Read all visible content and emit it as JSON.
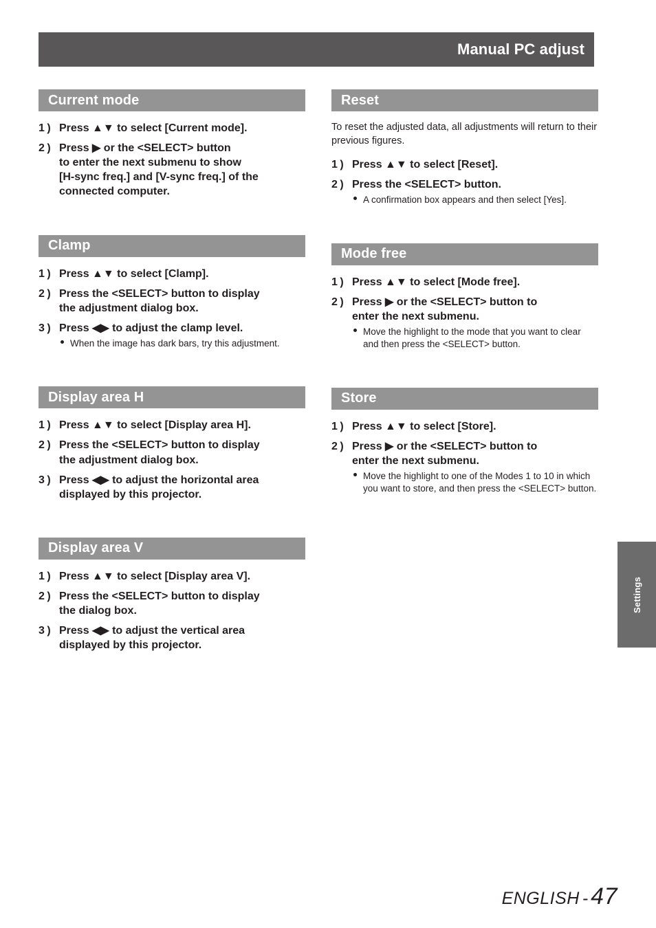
{
  "header": {
    "title": "Manual PC adjust"
  },
  "left_column": {
    "sections": [
      {
        "heading": "Current mode",
        "intro": "",
        "steps": [
          {
            "num": "1 )",
            "lines": [
              "Press ▲▼ to select [Current mode]."
            ],
            "notes": []
          },
          {
            "num": "2 )",
            "lines": [
              "Press ▶ or the <SELECT> button",
              "to enter the next submenu to show",
              "[H-sync freq.] and [V-sync freq.] of the",
              "connected computer."
            ],
            "notes": []
          }
        ]
      },
      {
        "heading": "Clamp",
        "intro": "",
        "steps": [
          {
            "num": "1 )",
            "lines": [
              "Press ▲▼ to select [Clamp]."
            ],
            "notes": []
          },
          {
            "num": "2 )",
            "lines": [
              "Press the <SELECT> button to display",
              "the adjustment dialog box."
            ],
            "notes": []
          },
          {
            "num": "3 )",
            "lines": [
              "Press ◀▶ to adjust the clamp level."
            ],
            "notes": [
              "When the image has dark bars, try this adjustment."
            ]
          }
        ]
      },
      {
        "heading": "Display area H",
        "intro": "",
        "steps": [
          {
            "num": "1 )",
            "lines": [
              "Press ▲▼ to select [Display area H]."
            ],
            "notes": []
          },
          {
            "num": "2 )",
            "lines": [
              "Press the <SELECT> button to display",
              "the adjustment dialog box."
            ],
            "notes": []
          },
          {
            "num": "3 )",
            "lines": [
              "Press ◀▶ to adjust the horizontal area",
              "displayed by this projector."
            ],
            "notes": []
          }
        ]
      },
      {
        "heading": "Display area V",
        "intro": "",
        "steps": [
          {
            "num": "1 )",
            "lines": [
              "Press ▲▼ to select [Display area V]."
            ],
            "notes": []
          },
          {
            "num": "2 )",
            "lines": [
              "Press the <SELECT> button to display",
              "the dialog box."
            ],
            "notes": []
          },
          {
            "num": "3 )",
            "lines": [
              "Press ◀▶ to adjust the vertical area",
              "displayed by this projector."
            ],
            "notes": []
          }
        ]
      }
    ]
  },
  "right_column": {
    "sections": [
      {
        "heading": "Reset",
        "intro": "To reset the adjusted data, all adjustments will return to their previous figures.",
        "steps": [
          {
            "num": "1 )",
            "lines": [
              "Press ▲▼ to select [Reset]."
            ],
            "notes": []
          },
          {
            "num": "2 )",
            "lines": [
              "Press the <SELECT> button."
            ],
            "notes": [
              "A confirmation box appears and then select [Yes]."
            ]
          }
        ]
      },
      {
        "heading": "Mode free",
        "intro": "",
        "steps": [
          {
            "num": "1 )",
            "lines": [
              "Press ▲▼ to select [Mode free]."
            ],
            "notes": []
          },
          {
            "num": "2 )",
            "lines": [
              "Press ▶ or the <SELECT> button to",
              "enter the next submenu."
            ],
            "notes": [
              "Move the highlight to the mode that you want to clear and then press the <SELECT> button."
            ]
          }
        ]
      },
      {
        "heading": "Store",
        "intro": "",
        "steps": [
          {
            "num": "1 )",
            "lines": [
              "Press ▲▼ to select [Store]."
            ],
            "notes": []
          },
          {
            "num": "2 )",
            "lines": [
              "Press ▶ or the <SELECT> button to",
              "enter the next submenu."
            ],
            "notes": [
              "Move the highlight to one of the Modes 1 to 10 in which you want to store, and then press the <SELECT> button."
            ]
          }
        ]
      }
    ]
  },
  "side_tab": {
    "label": "Settings"
  },
  "footer": {
    "language": "ENGLISH",
    "separator": "-",
    "page_number": "47"
  },
  "colors": {
    "header_bar": "#595757",
    "section_bar": "#949494",
    "side_tab": "#6d6c6c",
    "text": "#231f20"
  }
}
